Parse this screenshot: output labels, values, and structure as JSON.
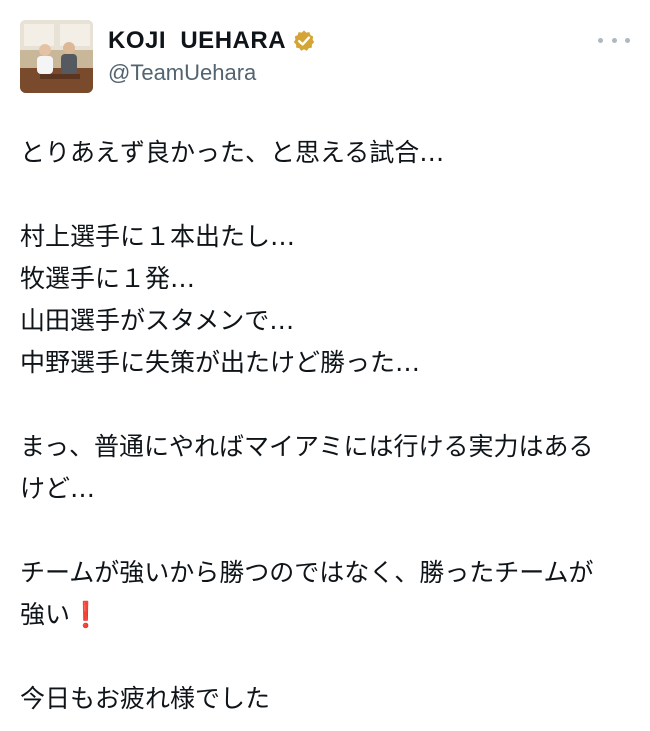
{
  "author": {
    "display_name": "KOJI  UEHARA",
    "handle": "@TeamUehara",
    "verified_badge_icon": "verified-badge-gold",
    "badge_color": "#d4a536"
  },
  "more_icon": "more-horizontal-icon",
  "tweet": {
    "lines": [
      "とりあえず良かった、と思える試合…",
      "",
      "村上選手に１本出たし…",
      "牧選手に１発…",
      "山田選手がスタメンで…",
      "中野選手に失策が出たけど勝った…",
      "",
      "まっ、普通にやればマイアミには行ける実力はある",
      "けど…",
      "",
      "チームが強いから勝つのではなく、勝ったチームが",
      "強い",
      "",
      "今日もお疲れ様でした"
    ],
    "exclamation_emoji": "❗"
  }
}
